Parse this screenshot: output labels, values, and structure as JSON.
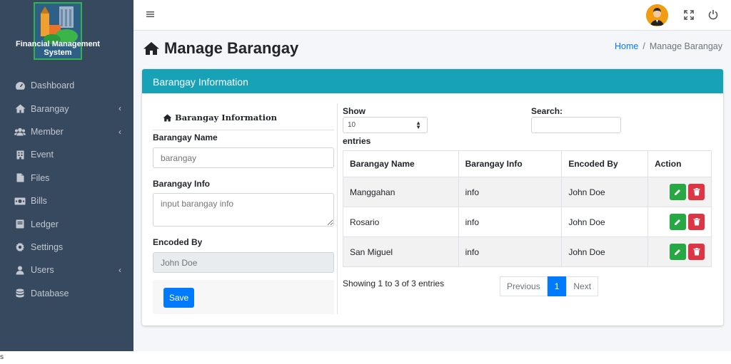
{
  "brand": {
    "line1": "Financial Management",
    "line2": "System"
  },
  "sidebar": {
    "items": [
      {
        "label": "Dashboard",
        "icon": "dashboard-icon",
        "has_submenu": false
      },
      {
        "label": "Barangay",
        "icon": "home-icon",
        "has_submenu": true
      },
      {
        "label": "Member",
        "icon": "users-icon",
        "has_submenu": true
      },
      {
        "label": "Event",
        "icon": "building-icon",
        "has_submenu": false
      },
      {
        "label": "Files",
        "icon": "file-icon",
        "has_submenu": false
      },
      {
        "label": "Bills",
        "icon": "money-icon",
        "has_submenu": false
      },
      {
        "label": "Ledger",
        "icon": "book-icon",
        "has_submenu": false
      },
      {
        "label": "Settings",
        "icon": "gear-icon",
        "has_submenu": false
      },
      {
        "label": "Users",
        "icon": "user-icon",
        "has_submenu": true
      },
      {
        "label": "Database",
        "icon": "database-icon",
        "has_submenu": false
      }
    ]
  },
  "header": {
    "title": "Manage Barangay"
  },
  "breadcrumb": {
    "home": "Home",
    "current": "Manage Barangay"
  },
  "card": {
    "title": "Barangay Information"
  },
  "form": {
    "title": "Barangay Information",
    "name_label": "Barangay Name",
    "name_placeholder": "barangay",
    "info_label": "Barangay Info",
    "info_placeholder": "input barangay info",
    "encoded_label": "Encoded By",
    "encoded_value": "John Doe",
    "save_label": "Save"
  },
  "table": {
    "show_label": "Show",
    "page_size": "10",
    "entries_label": "entries",
    "search_label": "Search:",
    "columns": [
      "Barangay Name",
      "Barangay Info",
      "Encoded By",
      "Action"
    ],
    "rows": [
      {
        "name": "Manggahan",
        "info": "info",
        "encoded_by": "John Doe"
      },
      {
        "name": "Rosario",
        "info": "info",
        "encoded_by": "John Doe"
      },
      {
        "name": "San Miguel",
        "info": "info",
        "encoded_by": "John Doe"
      }
    ],
    "summary": "Showing 1 to 3 of 3 entries",
    "pagination": {
      "previous": "Previous",
      "current": "1",
      "next": "Next"
    }
  },
  "footer_fragment": "s",
  "colors": {
    "sidebar": "#36495f",
    "header_accent": "#17a2b8",
    "primary": "#007bff",
    "success": "#28a745",
    "danger": "#dc3545"
  }
}
